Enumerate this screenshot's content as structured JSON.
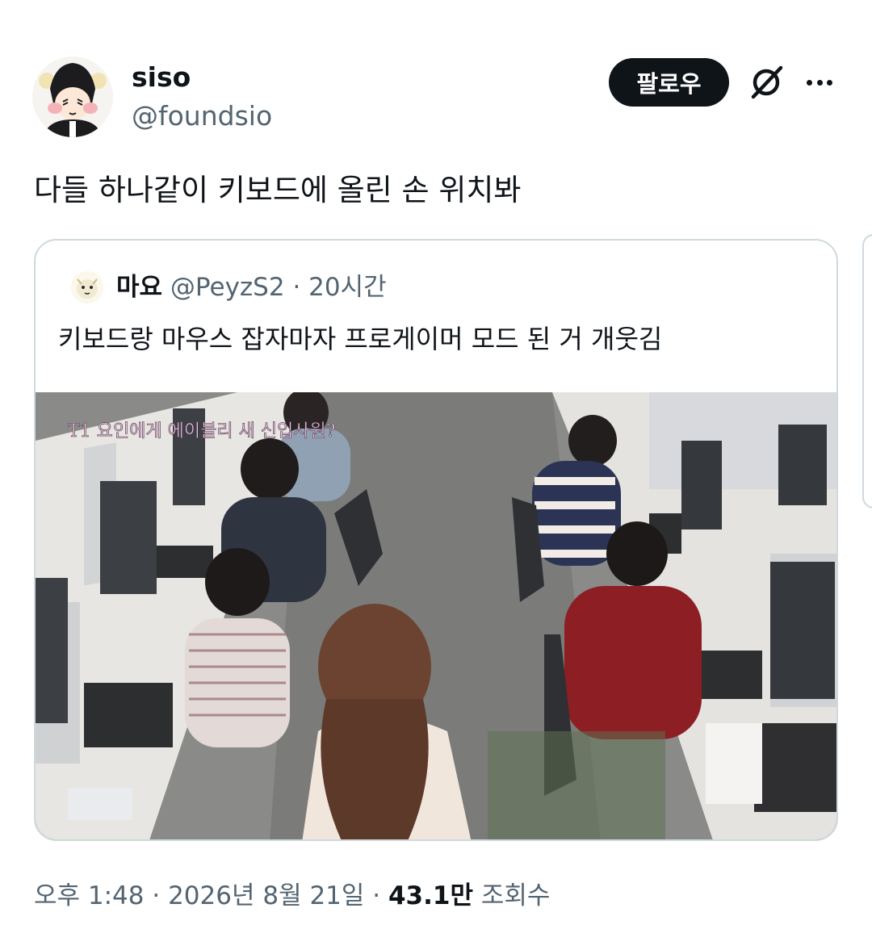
{
  "author": {
    "name": "siso",
    "handle": "@foundsio",
    "follow_label": "팔로우"
  },
  "tweet": {
    "text": "다들 하나같이 키보드에 올린 손 위치봐"
  },
  "quoted_tweet": {
    "name": "마요",
    "handle": "@PeyzS2",
    "separator": "·",
    "time": "20시간",
    "text": "키보드랑 마우스 잡자마자 프로게이머 모드 된 거 개웃김",
    "image_caption": "T1 요인에게 에이블리 새 신입사원?"
  },
  "footer": {
    "time": "오후 1:48",
    "sep1": " · ",
    "date": "2026년 8월 21일",
    "sep2": " · ",
    "views_count": "43.1만",
    "views_label": " 조회수"
  },
  "icons": {
    "grok": "grok-icon",
    "more": "more-icon"
  },
  "colors": {
    "text": "#0f1419",
    "secondary": "#536471",
    "border": "#cfd9de",
    "button": "#0f1419"
  }
}
